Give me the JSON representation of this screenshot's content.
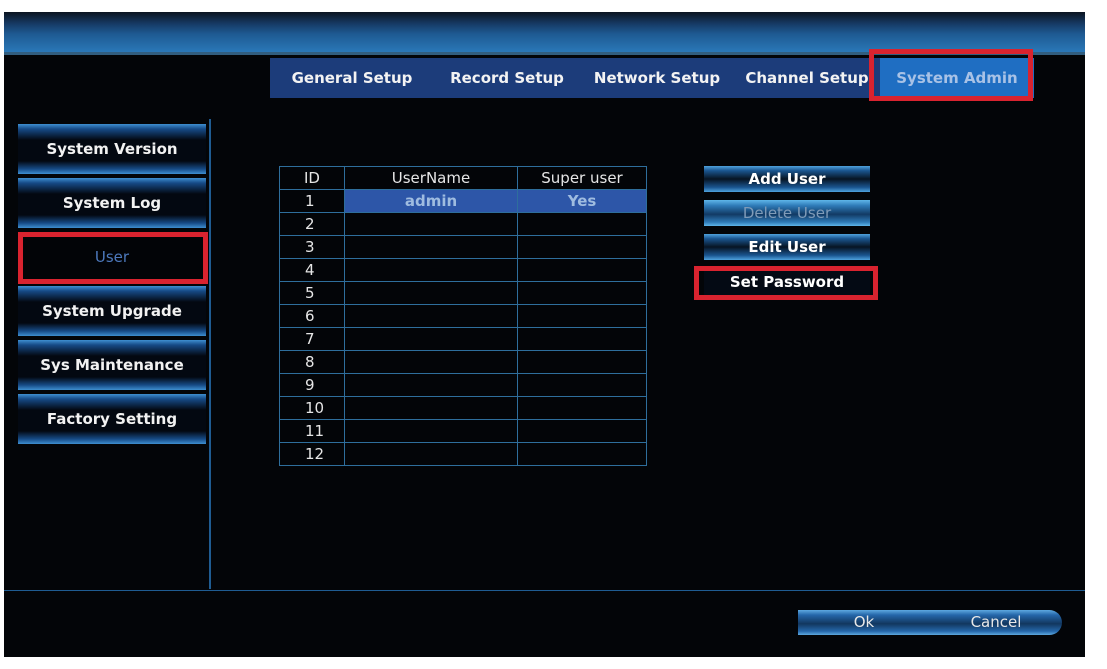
{
  "tabs": [
    {
      "label": "General Setup",
      "active": false
    },
    {
      "label": "Record Setup",
      "active": false
    },
    {
      "label": "Network Setup",
      "active": false
    },
    {
      "label": "Channel Setup",
      "active": false
    },
    {
      "label": "System Admin",
      "active": true
    }
  ],
  "sidebar": {
    "items": [
      {
        "label": "System Version"
      },
      {
        "label": "System Log"
      },
      {
        "label": "User",
        "selected": true
      },
      {
        "label": "System Upgrade"
      },
      {
        "label": "Sys Maintenance"
      },
      {
        "label": "Factory Setting"
      }
    ]
  },
  "user_table": {
    "columns": [
      "ID",
      "UserName",
      "Super user"
    ],
    "rows": [
      {
        "id": "1",
        "username": "admin",
        "super_user": "Yes"
      },
      {
        "id": "2",
        "username": "",
        "super_user": ""
      },
      {
        "id": "3",
        "username": "",
        "super_user": ""
      },
      {
        "id": "4",
        "username": "",
        "super_user": ""
      },
      {
        "id": "5",
        "username": "",
        "super_user": ""
      },
      {
        "id": "6",
        "username": "",
        "super_user": ""
      },
      {
        "id": "7",
        "username": "",
        "super_user": ""
      },
      {
        "id": "8",
        "username": "",
        "super_user": ""
      },
      {
        "id": "9",
        "username": "",
        "super_user": ""
      },
      {
        "id": "10",
        "username": "",
        "super_user": ""
      },
      {
        "id": "11",
        "username": "",
        "super_user": ""
      },
      {
        "id": "12",
        "username": "",
        "super_user": ""
      }
    ]
  },
  "actions": {
    "add_user": "Add User",
    "delete_user": "Delete User",
    "edit_user": "Edit User",
    "set_password": "Set Password"
  },
  "footer": {
    "ok": "Ok",
    "cancel": "Cancel"
  },
  "colors": {
    "highlight": "#d9232f",
    "tab_bar": "#1c3c7a",
    "tab_active": "#1f6ec2",
    "selected_row": "#2d56a8",
    "grid_line": "#2e6e9c"
  }
}
